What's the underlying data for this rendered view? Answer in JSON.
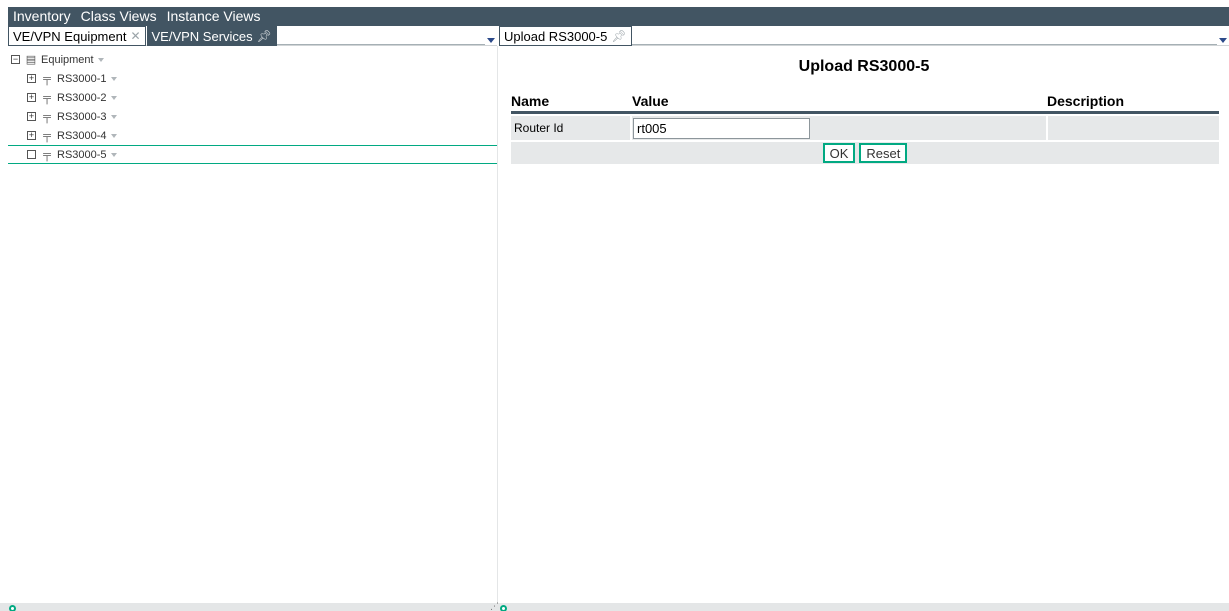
{
  "menubar": {
    "items": [
      "Inventory",
      "Class Views",
      "Instance Views"
    ]
  },
  "left_tabs": {
    "tabs": [
      {
        "label": "VE/VPN Equipment",
        "icon": "close-icon"
      },
      {
        "label": "VE/VPN Services",
        "icon": "pin-icon"
      }
    ]
  },
  "right_tabs": {
    "tabs": [
      {
        "label": "Upload RS3000-5",
        "icon": "pin-icon"
      }
    ]
  },
  "tree": {
    "root": {
      "label": "Equipment",
      "icon": "database-icon",
      "expander": "−"
    },
    "children": [
      {
        "label": "RS3000-1",
        "icon": "router-icon",
        "expander": "+"
      },
      {
        "label": "RS3000-2",
        "icon": "router-icon",
        "expander": "+"
      },
      {
        "label": "RS3000-3",
        "icon": "router-icon",
        "expander": "+"
      },
      {
        "label": "RS3000-4",
        "icon": "router-icon",
        "expander": "+"
      },
      {
        "label": "RS3000-5",
        "icon": "router-icon",
        "expander": "",
        "selected": true
      }
    ]
  },
  "form": {
    "title": "Upload RS3000-5",
    "columns": {
      "name": "Name",
      "value": "Value",
      "description": "Description"
    },
    "rows": [
      {
        "name": "Router Id",
        "value": "rt005",
        "description": ""
      }
    ],
    "ok_label": "OK",
    "reset_label": "Reset"
  },
  "colors": {
    "header_bg": "#425563",
    "accent": "#01a982",
    "row_bg": "#e6e8e9"
  }
}
